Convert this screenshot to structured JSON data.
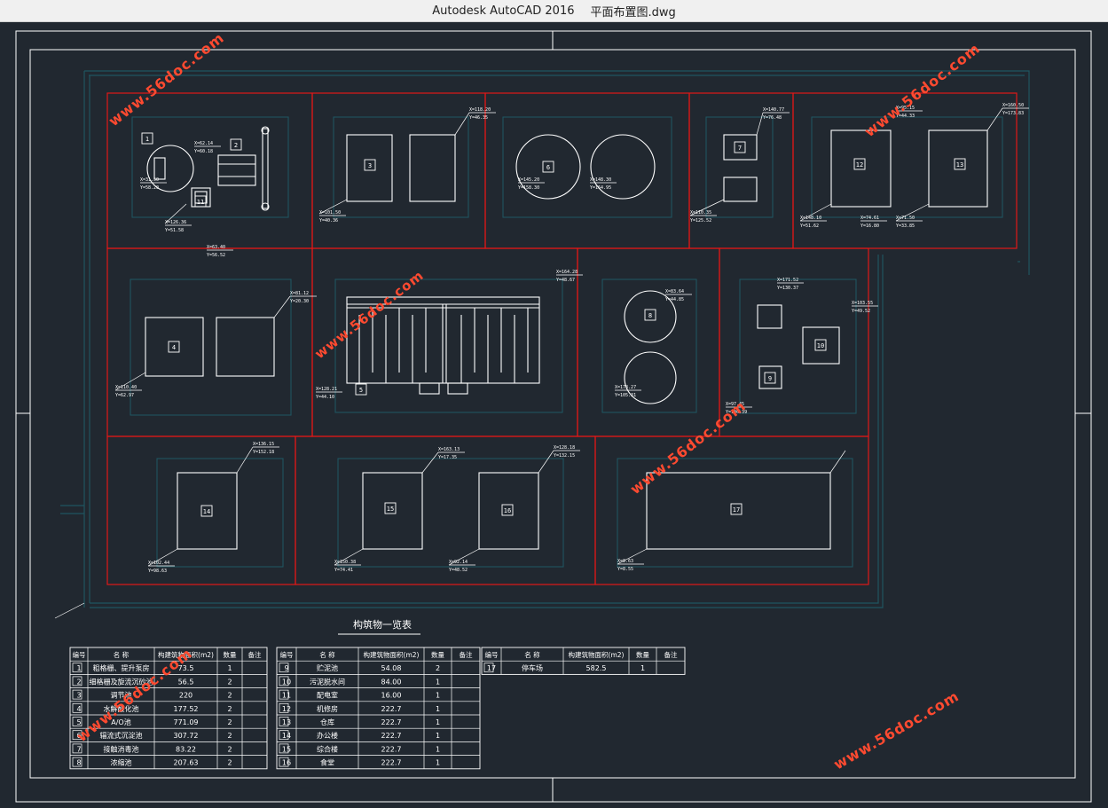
{
  "window": {
    "app_name": "Autodesk AutoCAD 2016",
    "file_name": "平面布置图.dwg"
  },
  "colors": {
    "background": "#212830",
    "frame": "#ffffff",
    "block": "#e01818",
    "service": "#1f5560",
    "structure": "#ffffff",
    "watermark": "#ff4a30"
  },
  "watermark": "www.56doc.com",
  "buildings": [
    {
      "id": "1"
    },
    {
      "id": "2"
    },
    {
      "id": "3"
    },
    {
      "id": "4"
    },
    {
      "id": "5"
    },
    {
      "id": "6"
    },
    {
      "id": "7"
    },
    {
      "id": "8"
    },
    {
      "id": "9"
    },
    {
      "id": "10"
    },
    {
      "id": "11"
    },
    {
      "id": "12"
    },
    {
      "id": "13"
    },
    {
      "id": "14"
    },
    {
      "id": "15"
    },
    {
      "id": "16"
    },
    {
      "id": "17"
    }
  ],
  "coords": [
    "X=31.50",
    "Y=58.20",
    "X=126.36",
    "Y=51.58",
    "X=62.14",
    "Y=60.18",
    "X=63.40",
    "Y=56.52",
    "X=101.50",
    "Y=40.36",
    "X=118.20",
    "Y=46.35",
    "X=145.20",
    "Y=158.30",
    "X=148.30",
    "Y=164.95",
    "X=110.35",
    "Y=125.52",
    "X=140.77",
    "Y=76.48",
    "X=148.10",
    "Y=51.62",
    "X=160.50",
    "Y=173.83",
    "X=95.15",
    "Y=44.33",
    "X=74.61",
    "Y=16.80",
    "X=71.50",
    "Y=33.85",
    "X=110.40",
    "Y=62.97",
    "X=81.12",
    "Y=20.30",
    "X=128.21",
    "Y=44.10",
    "X=164.28",
    "Y=48.67",
    "X=178.27",
    "Y=105.31",
    "X=83.64",
    "Y=44.85",
    "X=103.55",
    "Y=49.52",
    "X=171.52",
    "Y=130.37",
    "X=97.45",
    "Y=146.39",
    "X=136.15",
    "Y=152.18",
    "X=163.13",
    "Y=17.35",
    "X=102.44",
    "Y=98.63",
    "X=150.38",
    "Y=74.41",
    "X=92.14",
    "Y=48.52",
    "X=128.18",
    "Y=132.15",
    "X=8.63",
    "Y=8.55"
  ],
  "building_table": {
    "title": "构筑物一览表",
    "headers": [
      "编号",
      "名 称",
      "构建筑物面积(m2)",
      "数量",
      "备注"
    ],
    "left_rows": [
      [
        "1",
        "粗格栅、提升泵房",
        "73.5",
        "1",
        ""
      ],
      [
        "2",
        "细格栅及旋流沉砂池",
        "56.5",
        "2",
        ""
      ],
      [
        "3",
        "调节池",
        "220",
        "2",
        ""
      ],
      [
        "4",
        "水解酸化池",
        "177.52",
        "2",
        ""
      ],
      [
        "5",
        "A/O池",
        "771.09",
        "2",
        ""
      ],
      [
        "6",
        "辐流式沉淀池",
        "307.72",
        "2",
        ""
      ],
      [
        "7",
        "接触消毒池",
        "83.22",
        "2",
        ""
      ],
      [
        "8",
        "浓缩池",
        "207.63",
        "2",
        ""
      ]
    ],
    "mid_rows": [
      [
        "9",
        "贮泥池",
        "54.08",
        "2",
        ""
      ],
      [
        "10",
        "污泥脱水间",
        "84.00",
        "1",
        ""
      ],
      [
        "11",
        "配电室",
        "16.00",
        "1",
        ""
      ],
      [
        "12",
        "机修房",
        "222.7",
        "1",
        ""
      ],
      [
        "13",
        "仓库",
        "222.7",
        "1",
        ""
      ],
      [
        "14",
        "办公楼",
        "222.7",
        "1",
        ""
      ],
      [
        "15",
        "综合楼",
        "222.7",
        "1",
        ""
      ],
      [
        "16",
        "食堂",
        "222.7",
        "1",
        ""
      ]
    ],
    "right_rows": [
      [
        "17",
        "停车场",
        "582.5",
        "1",
        ""
      ]
    ]
  }
}
